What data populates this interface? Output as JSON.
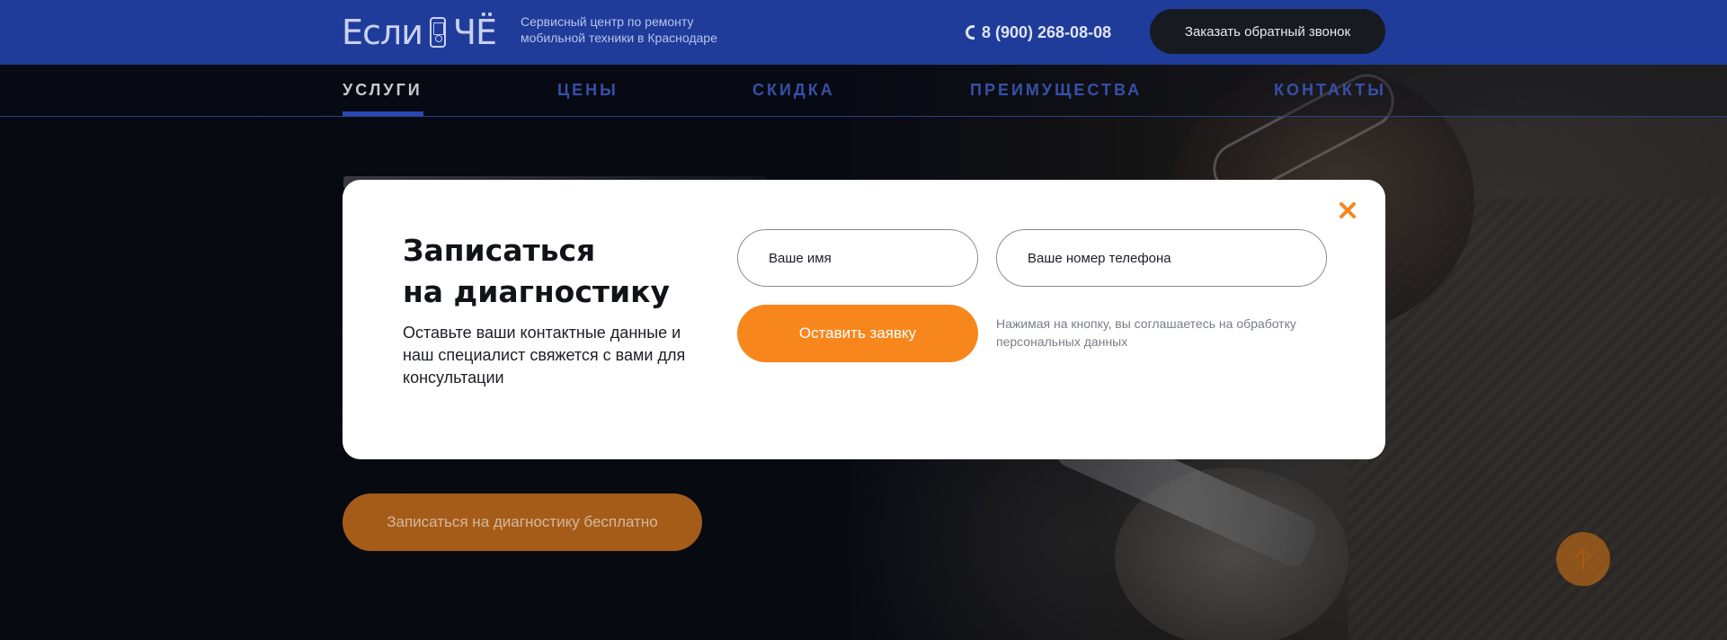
{
  "header": {
    "logo_text_left": "Если",
    "logo_text_right": "ЧЁ",
    "tagline": "Сервисный центр по ремонту мобильной техники в Краснодаре",
    "phone": "8 (900) 268-08-08",
    "callback_button": "Заказать обратный звонок"
  },
  "nav": {
    "items": [
      {
        "label": "УСЛУГИ",
        "active": true
      },
      {
        "label": "ЦЕНЫ",
        "active": false
      },
      {
        "label": "СКИДКА",
        "active": false
      },
      {
        "label": "ПРЕИМУЩЕСТВА",
        "active": false
      },
      {
        "label": "КОНТАКТЫ",
        "active": false
      }
    ]
  },
  "hero": {
    "cta_button": "Записаться на диагностику бесплатно"
  },
  "modal": {
    "title_line1": "Записаться",
    "title_line2": "на диагностику",
    "description": "Оставьте ваши контактные данные и наш специалист свяжется с вами для консультации",
    "name_placeholder": "Ваше имя",
    "phone_placeholder": "Ваше номер телефона",
    "submit_button": "Оставить заявку",
    "consent": "Нажимая на кнопку, вы соглашаетесь на обработку персональных данных"
  },
  "colors": {
    "header_bg": "#1f3c9a",
    "accent_orange": "#f7871d",
    "nav_inactive": "#3550a8",
    "nav_active": "#c8c9cf"
  },
  "icons": {
    "close": "close-icon",
    "phone": "phone-icon",
    "scroll_top": "arrow-up-icon"
  }
}
